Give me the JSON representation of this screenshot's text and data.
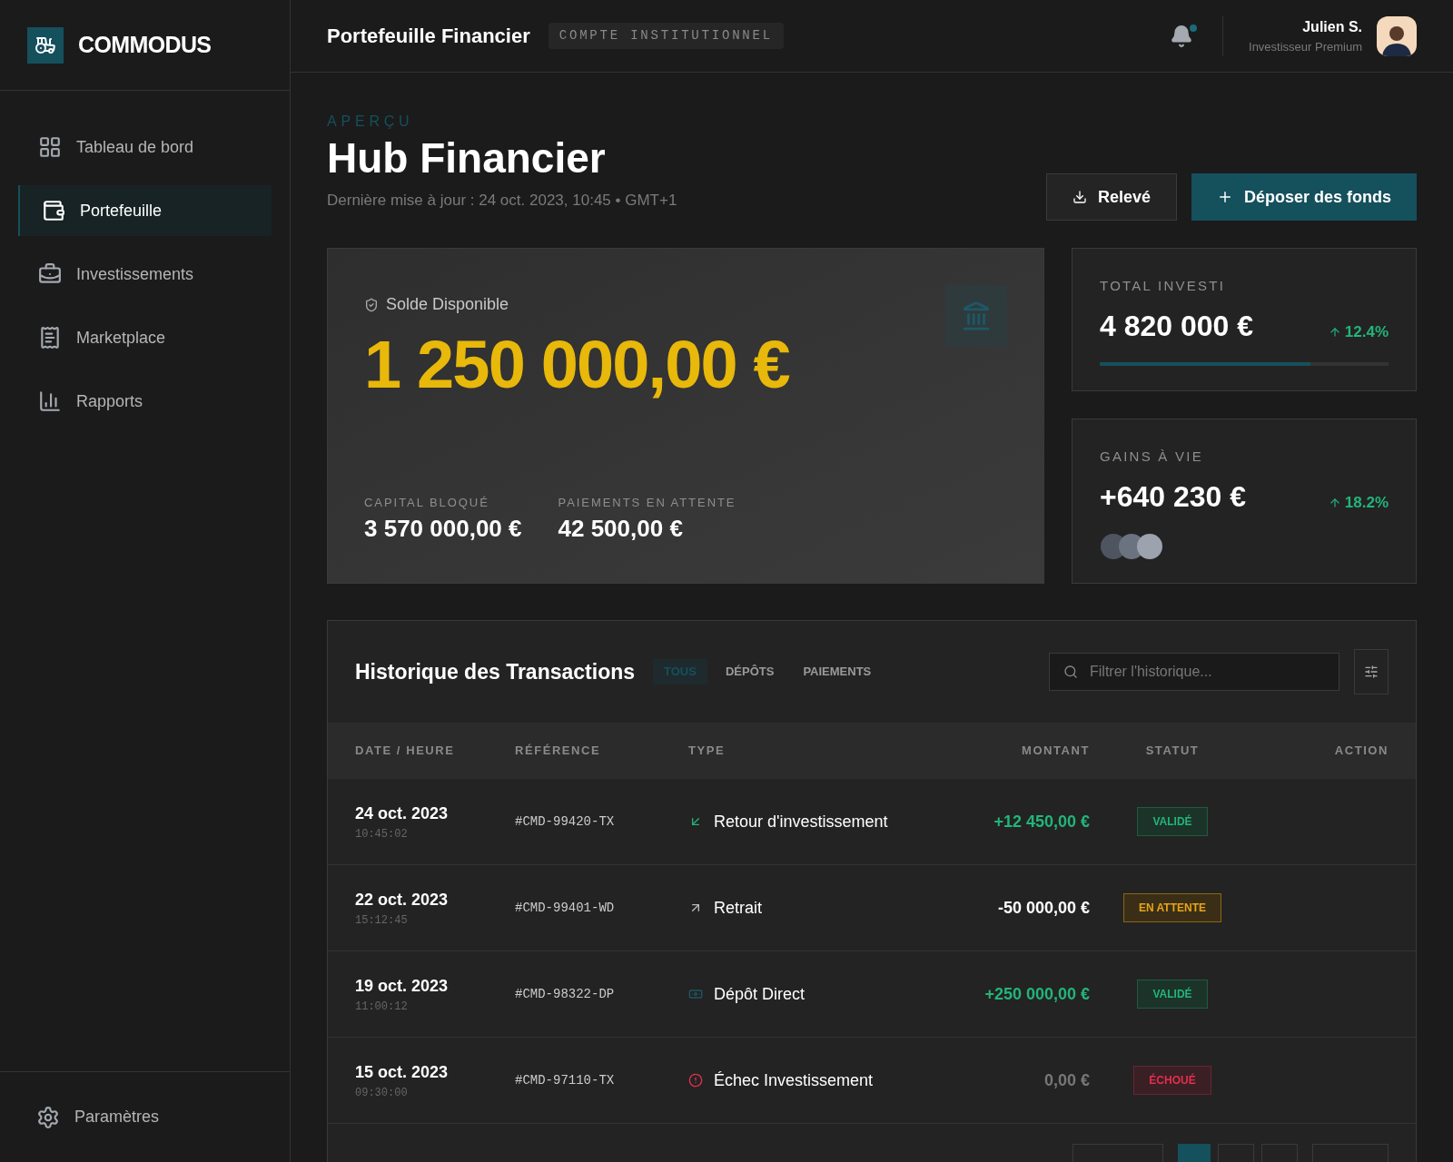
{
  "brand": {
    "name": "COMMODUS"
  },
  "sidebar": {
    "items": [
      {
        "label": "Tableau de bord",
        "kind": "grid",
        "selected": false
      },
      {
        "label": "Portefeuille",
        "kind": "wallet",
        "selected": true
      },
      {
        "label": "Investissements",
        "kind": "briefcase",
        "selected": false
      },
      {
        "label": "Marketplace",
        "kind": "receipt",
        "selected": false
      },
      {
        "label": "Rapports",
        "kind": "chart",
        "selected": false
      }
    ],
    "footer": {
      "label": "Paramètres"
    }
  },
  "header": {
    "title": "Portefeuille Financier",
    "badge": "COMPTE INSTITUTIONNEL",
    "notifications": {
      "unread": true
    },
    "user": {
      "name": "Julien S.",
      "role": "Investisseur Premium"
    }
  },
  "page": {
    "eyebrow": "APERÇU",
    "title": "Hub Financier",
    "updated": "Dernière mise à jour : 24 oct. 2023, 10:45 • GMT+1",
    "buttons": [
      {
        "label": "Relevé",
        "kind": "secondary"
      },
      {
        "label": "Déposer des fonds",
        "kind": "primary"
      }
    ]
  },
  "balance": {
    "label": "Solde Disponible",
    "amount": "1 250 000,00 €",
    "stats": [
      {
        "label": "CAPITAL BLOQUÉ",
        "value": "3 570 000,00 €"
      },
      {
        "label": "PAIEMENTS EN ATTENTE",
        "value": "42 500,00 €"
      }
    ]
  },
  "total_invested": {
    "label": "TOTAL INVESTI",
    "value": "4 820 000 €",
    "change": "12.4%",
    "level": 0.73
  },
  "lifetime_gains": {
    "label": "GAINS À VIE",
    "value": "+640 230 €",
    "change": "18.2%"
  },
  "transactions": {
    "title": "Historique des Transactions",
    "tabs": [
      {
        "label": "TOUS",
        "selected": true
      },
      {
        "label": "DÉPÔTS",
        "selected": false
      },
      {
        "label": "PAIEMENTS",
        "selected": false
      }
    ],
    "search": {
      "placeholder": "Filtrer l'historique..."
    },
    "columns": [
      "DATE / HEURE",
      "RÉFÉRENCE",
      "TYPE",
      "MONTANT",
      "STATUT",
      "ACTION"
    ],
    "rows": [
      {
        "date": "24 oct. 2023",
        "time": "10:45:02",
        "reference": "#CMD-99420-TX",
        "kind": "return",
        "type": "Retour d'investissement",
        "amount": "+12 450,00 €",
        "status": {
          "label": "VALIDÉ",
          "kind": "valid"
        }
      },
      {
        "date": "22 oct. 2023",
        "time": "15:12:45",
        "reference": "#CMD-99401-WD",
        "kind": "withdrawal",
        "type": "Retrait",
        "amount": "-50 000,00 €",
        "status": {
          "label": "EN ATTENTE",
          "kind": "pending"
        }
      },
      {
        "date": "19 oct. 2023",
        "time": "11:00:12",
        "reference": "#CMD-98322-DP",
        "kind": "deposit",
        "type": "Dépôt Direct",
        "amount": "+250 000,00 €",
        "status": {
          "label": "VALIDÉ",
          "kind": "valid"
        }
      },
      {
        "date": "15 oct. 2023",
        "time": "09:30:00",
        "reference": "#CMD-97110-TX",
        "kind": "failed",
        "type": "Échec Investissement",
        "amount": "0,00 €",
        "status": {
          "label": "ÉCHOUÉ",
          "kind": "failed"
        }
      }
    ],
    "pagination": {
      "pages": [
        {
          "selected": true
        },
        {
          "selected": false
        },
        {
          "selected": false
        }
      ]
    }
  }
}
